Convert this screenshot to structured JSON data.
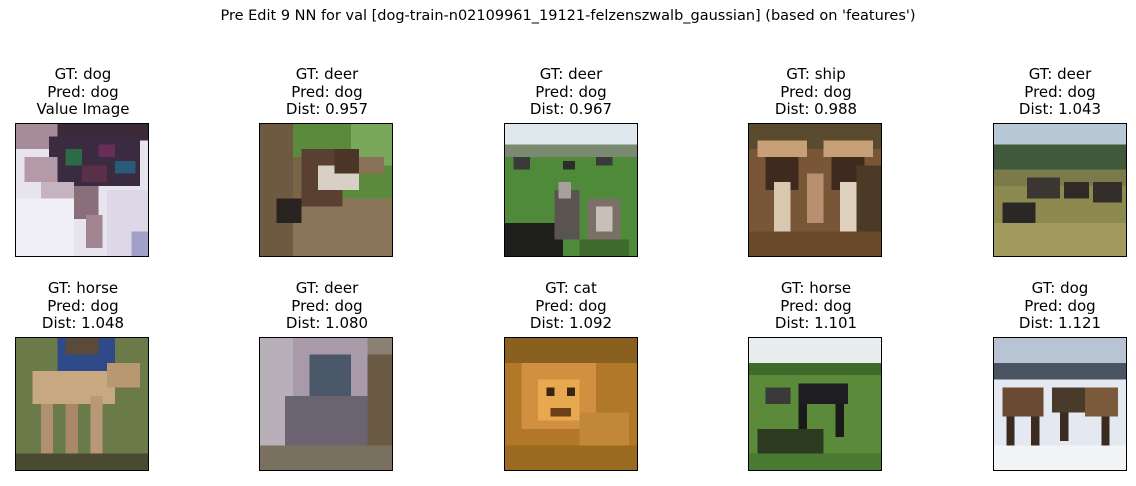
{
  "figure": {
    "title": "Pre Edit 9 NN for val [dog-train-n02109961_19121-felzenszwalb_gaussian] (based on 'features')"
  },
  "panels": [
    {
      "gt": "GT: dog",
      "pred": "Pred: dog",
      "extra": "Value Image",
      "image": "query-dog-pixelated"
    },
    {
      "gt": "GT: deer",
      "pred": "Pred: dog",
      "extra": "Dist: 0.957",
      "image": "goat-at-fence"
    },
    {
      "gt": "GT: deer",
      "pred": "Pred: dog",
      "extra": "Dist: 0.967",
      "image": "goats-in-field"
    },
    {
      "gt": "GT: ship",
      "pred": "Pred: dog",
      "extra": "Dist: 0.988",
      "image": "people-under-canopy"
    },
    {
      "gt": "GT: deer",
      "pred": "Pred: dog",
      "extra": "Dist: 1.043",
      "image": "animals-grazing-field"
    },
    {
      "gt": "GT: horse",
      "pred": "Pred: dog",
      "extra": "Dist: 1.048",
      "image": "foal-with-person"
    },
    {
      "gt": "GT: deer",
      "pred": "Pred: dog",
      "extra": "Dist: 1.080",
      "image": "blurry-animal"
    },
    {
      "gt": "GT: cat",
      "pred": "Pred: dog",
      "extra": "Dist: 1.092",
      "image": "lion-in-grass"
    },
    {
      "gt": "GT: horse",
      "pred": "Pred: dog",
      "extra": "Dist: 1.101",
      "image": "horses-on-grass"
    },
    {
      "gt": "GT: dog",
      "pred": "Pred: dog",
      "extra": "Dist: 1.121",
      "image": "dogs-on-snow"
    }
  ]
}
